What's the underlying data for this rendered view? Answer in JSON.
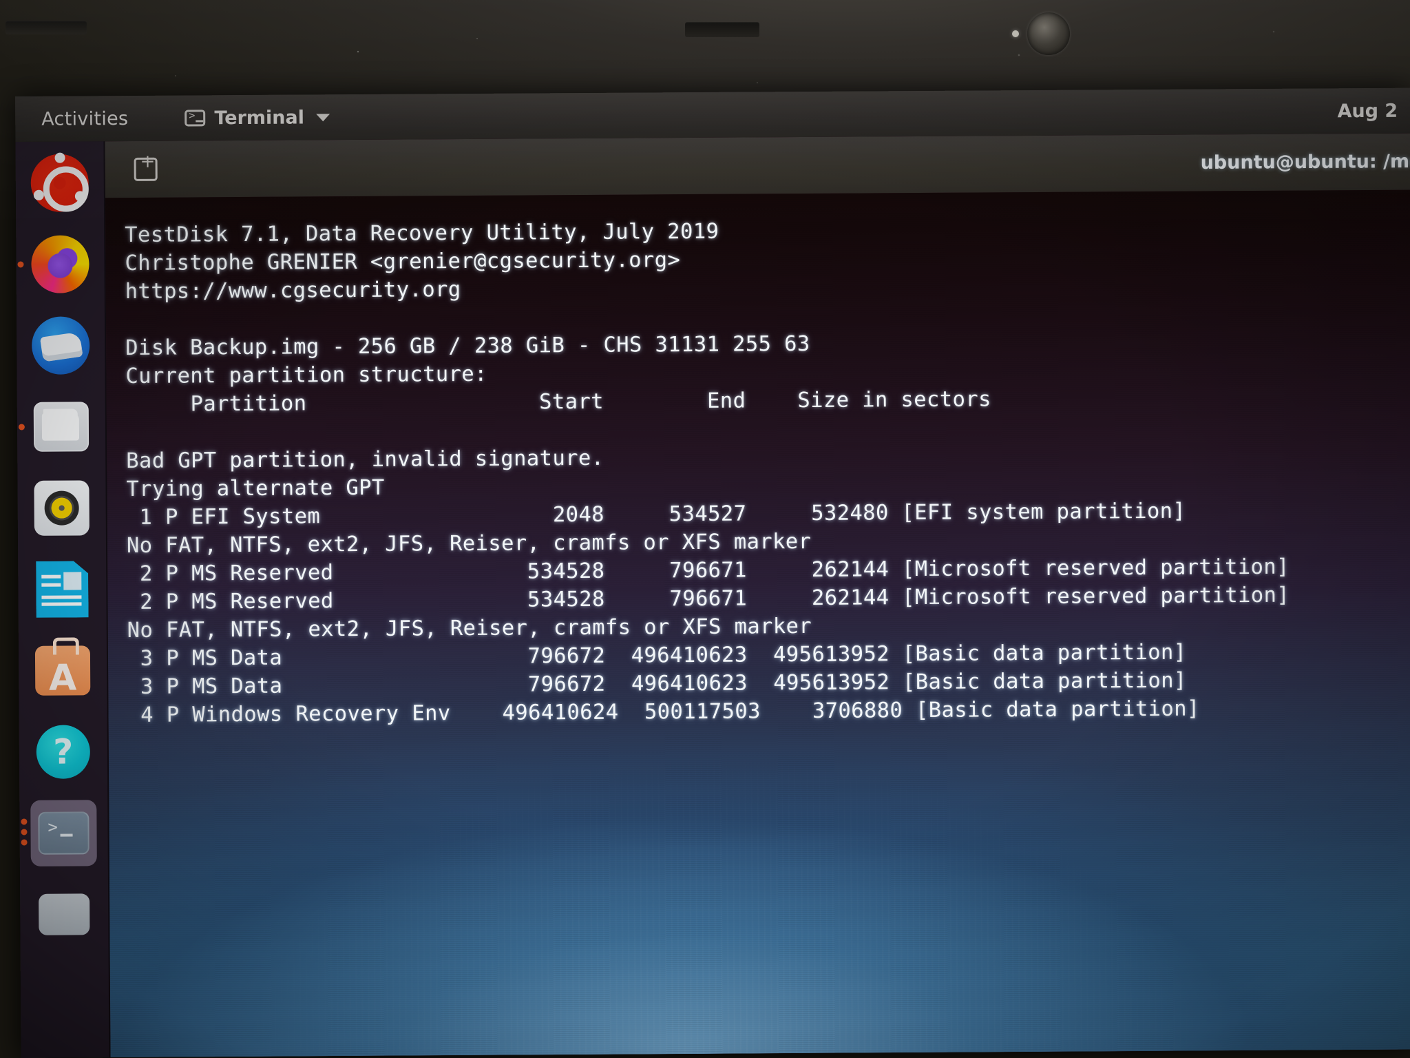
{
  "top_panel": {
    "activities_label": "Activities",
    "app_name": "Terminal",
    "clock": "Aug 2"
  },
  "dock": {
    "items": [
      {
        "name": "ubuntu-show-applications",
        "label": "Ubuntu Software Home",
        "icon": "ubuntu-icon"
      },
      {
        "name": "firefox",
        "label": "Firefox",
        "icon": "firefox-icon"
      },
      {
        "name": "thunderbird",
        "label": "Thunderbird Mail",
        "icon": "thunderbird-icon"
      },
      {
        "name": "files",
        "label": "Files",
        "icon": "folder-icon"
      },
      {
        "name": "rhythmbox",
        "label": "Rhythmbox",
        "icon": "music-disc-icon"
      },
      {
        "name": "libreoffice-writer",
        "label": "LibreOffice Writer",
        "icon": "document-icon"
      },
      {
        "name": "ubuntu-software",
        "label": "Ubuntu Software",
        "icon": "software-bag-icon"
      },
      {
        "name": "help",
        "label": "Help",
        "icon": "question-mark-icon"
      },
      {
        "name": "terminal",
        "label": "Terminal",
        "icon": "terminal-icon"
      },
      {
        "name": "trash",
        "label": "Trash",
        "icon": "trash-icon"
      }
    ]
  },
  "terminal": {
    "new_tab_label": "+",
    "title": "ubuntu@ubuntu: /media/ub",
    "lines": [
      "TestDisk 7.1, Data Recovery Utility, July 2019",
      "Christophe GRENIER <grenier@cgsecurity.org>",
      "https://www.cgsecurity.org",
      "",
      "Disk Backup.img - 256 GB / 238 GiB - CHS 31131 255 63",
      "Current partition structure:",
      "     Partition                  Start        End    Size in sectors",
      "",
      "Bad GPT partition, invalid signature.",
      "Trying alternate GPT",
      " 1 P EFI System                  2048     534527     532480 [EFI system partition]",
      "No FAT, NTFS, ext2, JFS, Reiser, cramfs or XFS marker",
      " 2 P MS Reserved               534528     796671     262144 [Microsoft reserved partition]",
      " 2 P MS Reserved               534528     796671     262144 [Microsoft reserved partition]",
      "No FAT, NTFS, ext2, JFS, Reiser, cramfs or XFS marker",
      " 3 P MS Data                   796672  496410623  495613952 [Basic data partition]",
      " 3 P MS Data                   796672  496410623  495613952 [Basic data partition]",
      " 4 P Windows Recovery Env    496410624  500117503    3706880 [Basic data partition]"
    ],
    "header_columns": [
      "Partition",
      "Start",
      "End",
      "Size in sectors"
    ],
    "partitions": [
      {
        "index": "1",
        "type": "P",
        "name": "EFI System",
        "start": "2048",
        "end": "534527",
        "size_sectors": "532480",
        "label": "[EFI system partition]"
      },
      {
        "index": "2",
        "type": "P",
        "name": "MS Reserved",
        "start": "534528",
        "end": "796671",
        "size_sectors": "262144",
        "label": "[Microsoft reserved partition]"
      },
      {
        "index": "2",
        "type": "P",
        "name": "MS Reserved",
        "start": "534528",
        "end": "796671",
        "size_sectors": "262144",
        "label": "[Microsoft reserved partition]"
      },
      {
        "index": "3",
        "type": "P",
        "name": "MS Data",
        "start": "796672",
        "end": "496410623",
        "size_sectors": "495613952",
        "label": "[Basic data partition]"
      },
      {
        "index": "3",
        "type": "P",
        "name": "MS Data",
        "start": "796672",
        "end": "496410623",
        "size_sectors": "495613952",
        "label": "[Basic data partition]"
      },
      {
        "index": "4",
        "type": "P",
        "name": "Windows Recovery Env",
        "start": "496410624",
        "end": "500117503",
        "size_sectors": "3706880",
        "label": "[Basic data partition]"
      }
    ],
    "messages": [
      "Bad GPT partition, invalid signature.",
      "Trying alternate GPT",
      "No FAT, NTFS, ext2, JFS, Reiser, cramfs or XFS marker"
    ],
    "app": {
      "name": "TestDisk",
      "version": "7.1",
      "description": "Data Recovery Utility",
      "date": "July 2019",
      "author": "Christophe GRENIER <grenier@cgsecurity.org>",
      "url": "https://www.cgsecurity.org",
      "disk": "Disk Backup.img - 256 GB / 238 GiB - CHS 31131 255 63",
      "structure_heading": "Current partition structure:"
    }
  },
  "colors": {
    "accent": "#e95420",
    "panel_bg": "#2e2b29",
    "dock_bg": "#3b2540",
    "terminal_text": "#f2f6f8"
  }
}
